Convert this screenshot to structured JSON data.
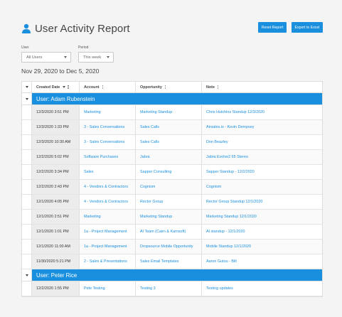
{
  "page": {
    "title": "User Activity Report",
    "user_icon": "user-icon"
  },
  "actions": {
    "reset_label": "Reset Report",
    "export_label": "Export to Excel"
  },
  "filters": {
    "user_label": "User",
    "user_value": "All Users",
    "period_label": "Period",
    "period_value": "This week"
  },
  "date_range": "Nov 29, 2020 to Dec 5, 2020",
  "colors": {
    "accent": "#1a8fde"
  },
  "table": {
    "columns": [
      "Created Date",
      "Account",
      "Opportunity",
      "Note"
    ],
    "groups": [
      {
        "label": "User: Adam Rubenstein",
        "rows": [
          {
            "date": "12/3/2020 3:51 PM",
            "account": "Marketing",
            "opportunity": "Marketing Standup",
            "note": "Chris Hutchins Standup 12/3/2020"
          },
          {
            "date": "12/3/2020 1:33 PM",
            "account": "3 - Sales Conversations",
            "opportunity": "Sales Calls",
            "note": "Airsales.io - Kevin Dempsey"
          },
          {
            "date": "12/3/2020 10:30 AM",
            "account": "3 - Sales Conversations",
            "opportunity": "Sales Calls",
            "note": "Don Beazley"
          },
          {
            "date": "12/2/2020 5:02 PM",
            "account": "Software Purchases",
            "opportunity": "Jabra",
            "note": "Jabra Evolve2 65 Stereo"
          },
          {
            "date": "12/2/2020 3:34 PM",
            "account": "Sales",
            "opportunity": "Sapper Consulting",
            "note": "Sapper Standup - 12/2/2020"
          },
          {
            "date": "12/2/2020 2:43 PM",
            "account": "4 - Vendors & Contractors",
            "opportunity": "Cognism",
            "note": "Cognism"
          },
          {
            "date": "12/1/2020 4:05 PM",
            "account": "4 - Vendors & Contractors",
            "opportunity": "Rector Group",
            "note": "Rector Group Standup 12/1/2020"
          },
          {
            "date": "12/1/2020 2:51 PM",
            "account": "Marketing",
            "opportunity": "Marketing Standup",
            "note": "Marketing Standup 12/1/2020"
          },
          {
            "date": "12/1/2020 1:01 PM",
            "account": "1a - Project Management",
            "opportunity": "AI Team (Cairn & Karnsoft)",
            "note": "AI standup - 12/1/2020"
          },
          {
            "date": "12/1/2020 11:00 AM",
            "account": "1a - Project Management",
            "opportunity": "Dropsource Mobile Opportunity",
            "note": "Mobile Standup 12/1/2020"
          },
          {
            "date": "11/30/2020 5:21 PM",
            "account": "2 - Sales & Presentations",
            "opportunity": "Sales Email Templates",
            "note": "Aaron Gutou - Bilt"
          }
        ]
      },
      {
        "label": "User: Peter Rice",
        "rows": [
          {
            "date": "12/2/2020 1:55 PM",
            "account": "Pete Testing",
            "opportunity": "Testing 3",
            "note": "Testing updates"
          }
        ]
      }
    ]
  }
}
